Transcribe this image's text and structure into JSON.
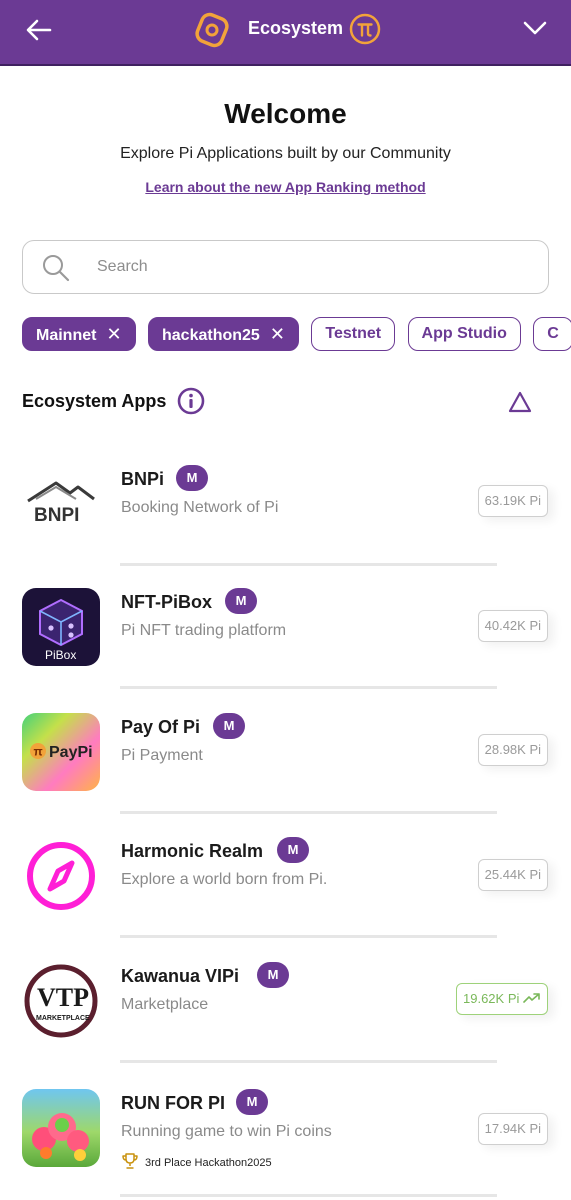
{
  "header": {
    "title": "Ecosystem",
    "back_icon": "arrow-left-icon",
    "menu_icon": "chevron-down-icon",
    "logo_icon": "ecosystem-logo-icon",
    "coin_icon": "pi-coin-icon",
    "bg_color": "#6b3a94"
  },
  "hero": {
    "title": "Welcome",
    "subtitle": "Explore Pi Applications built by our Community",
    "link": "Learn about the new App Ranking method"
  },
  "search": {
    "placeholder": "Search",
    "value": ""
  },
  "filters": [
    {
      "label": "Mainnet",
      "active": true
    },
    {
      "label": "hackathon25",
      "active": true
    },
    {
      "label": "Testnet",
      "active": false
    },
    {
      "label": "App Studio",
      "active": false
    },
    {
      "label": "C",
      "active": false
    }
  ],
  "section": {
    "title": "Ecosystem Apps",
    "info_icon": "info-icon",
    "sort_icon": "triangle-up-icon"
  },
  "apps": [
    {
      "name": "BNPi",
      "badge": "M",
      "desc": "Booking Network of Pi",
      "stat": "63.19K Pi",
      "trending": false,
      "icon_label": "BNPI"
    },
    {
      "name": "NFT-PiBox",
      "badge": "M",
      "desc": "Pi NFT trading platform",
      "stat": "40.42K Pi",
      "trending": false,
      "icon_label": "PiBox"
    },
    {
      "name": "Pay Of Pi",
      "badge": "M",
      "desc": "Pi Payment",
      "stat": "28.98K Pi",
      "trending": false,
      "icon_label": "PayPi"
    },
    {
      "name": "Harmonic Realm",
      "badge": "M",
      "desc": "Explore a world born from Pi.",
      "stat": "25.44K Pi",
      "trending": false,
      "icon_label": ""
    },
    {
      "name": "Kawanua VIPi",
      "badge": "M",
      "desc": "Marketplace",
      "stat": "19.62K Pi",
      "trending": true,
      "icon_label": "MARKETPLACE"
    },
    {
      "name": "RUN FOR PI",
      "badge": "M",
      "desc": "Running game to win Pi coins",
      "stat": "17.94K Pi",
      "trending": false,
      "award": "3rd Place Hackathon2025",
      "icon_label": ""
    }
  ]
}
